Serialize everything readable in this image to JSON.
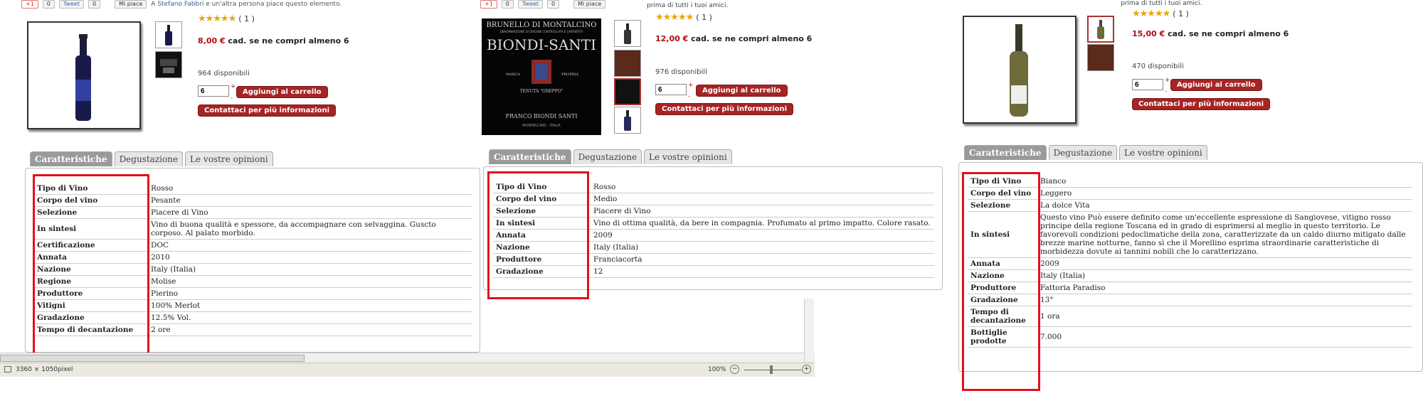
{
  "social": {
    "gplus": "+1",
    "gplus_count": "0",
    "tweet": "Tweet",
    "tweet_count": "0",
    "like": "Mi piace",
    "like_text_p1_name": "Stefano Fabbri",
    "like_text_p1_rest": "e un'altra persona piace questo elemento.",
    "like_text_p2": "prima di tutti i tuoi amici."
  },
  "tabs": [
    "Caratteristiche",
    "Degustazione",
    "Le vostre opinioni"
  ],
  "product1": {
    "rating_count": "( 1 )",
    "price": "8,00 €",
    "price_suffix": "cad. se ne compri almeno 6",
    "available": "964 disponibili",
    "qty": "6",
    "add_to_cart": "Aggiungi al carrello",
    "contact": "Contattaci per più informazioni",
    "specs": [
      {
        "k": "Tipo di Vino",
        "v": "Rosso"
      },
      {
        "k": "Corpo del vino",
        "v": "Pesante"
      },
      {
        "k": "Selezione",
        "v": "Piacere di Vino"
      },
      {
        "k": "In sintesi",
        "v": "Vino di buona qualità e spessore, da accompagnare con selvaggina. Guscto corposo. Al palato morbido."
      },
      {
        "k": "Certificazione",
        "v": "DOC"
      },
      {
        "k": "Annata",
        "v": "2010"
      },
      {
        "k": "Nazione",
        "v": "Italy (Italia)"
      },
      {
        "k": "Regione",
        "v": "Molise"
      },
      {
        "k": "Produttore",
        "v": "Pierino"
      },
      {
        "k": "Vitigni",
        "v": "100% Merlot"
      },
      {
        "k": "Gradazione",
        "v": "12.5% Vol."
      },
      {
        "k": "Tempo di decantazione",
        "v": "2 ore"
      }
    ]
  },
  "product2": {
    "rating_count": "( 1 )",
    "price": "12,00 €",
    "price_suffix": "cad. se ne compri almeno 6",
    "available": "976 disponibili",
    "qty": "6",
    "add_to_cart": "Aggiungi al carrello",
    "contact": "Contattaci per più informazioni",
    "label": {
      "line1": "BRUNELLO DI MONTALCINO",
      "line2": "DENOMINAZIONE DI ORIGINE CONTROLLATA E GARANTITA",
      "brand": "BIONDI-SANTI",
      "marca": "MARCA",
      "propria": "PROPRIA",
      "tenuta": "TENUTA \"GREPPO\"",
      "bottom1": "FRANCO BIONDI SANTI",
      "bottom2": "MONTALCINO - ITALIA"
    },
    "specs": [
      {
        "k": "Tipo di Vino",
        "v": "Rosso"
      },
      {
        "k": "Corpo del vino",
        "v": "Medio"
      },
      {
        "k": "Selezione",
        "v": "Piacere di Vino"
      },
      {
        "k": "In sintesi",
        "v": "Vino di ottima qualità, da bere in compagnia. Profumato al primo impatto. Colore rasato."
      },
      {
        "k": "Annata",
        "v": "2009"
      },
      {
        "k": "Nazione",
        "v": "Italy (Italia)"
      },
      {
        "k": "Produttore",
        "v": "Franciacorta"
      },
      {
        "k": "Gradazione",
        "v": "12"
      }
    ]
  },
  "product3": {
    "rating_count": "( 1 )",
    "price": "15,00 €",
    "price_suffix": "cad. se ne compri almeno 6",
    "available": "470 disponibili",
    "qty": "6",
    "add_to_cart": "Aggiungi al carrello",
    "contact": "Contattaci per più informazioni",
    "specs": [
      {
        "k": "Tipo di Vino",
        "v": "Bianco"
      },
      {
        "k": "Corpo del vino",
        "v": "Leggero"
      },
      {
        "k": "Selezione",
        "v": "La dolce Vita"
      },
      {
        "k": "In sintesi",
        "v": "Questo vino Può essere definito come un'eccellente espressione di Sangiovese, vitigno rosso principe della regione Toscana ed in grado di esprimersi al meglio in questo territorio. Le favorevoli condizioni pedoclimatiche della zona, caratterizzate da un caldo diurno mitigato dalle brezze marine notturne, fanno sì che il Morellino esprima straordinarie caratteristiche di morbidezza dovute ai tannini nobili che lo caratterizzano."
      },
      {
        "k": "Annata",
        "v": "2009"
      },
      {
        "k": "Nazione",
        "v": "Italy (Italia)"
      },
      {
        "k": "Produttore",
        "v": "Fattoria Paradiso"
      },
      {
        "k": "Gradazione",
        "v": "13°"
      },
      {
        "k": "Tempo di decantazione",
        "v": "1 ora"
      },
      {
        "k": "Bottiglie prodotte",
        "v": "7.000"
      }
    ]
  },
  "statusbar": {
    "dimensions": "3360 × 1050pixel",
    "zoom": "100%",
    "zoom_minus": "−",
    "zoom_plus": "+"
  },
  "colors": {
    "highlight_box": "#e3101b",
    "price": "#b10e12",
    "button": "#a52424",
    "stars": "#e8a40d"
  }
}
